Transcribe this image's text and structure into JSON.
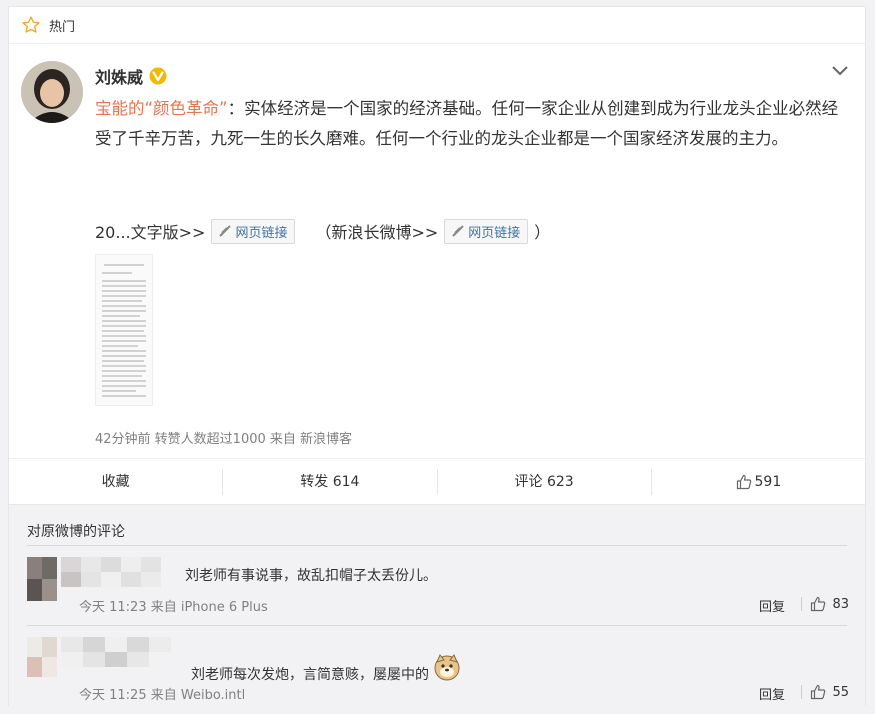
{
  "hot_bar": {
    "label": "热门"
  },
  "post": {
    "author": "刘姝威",
    "text_highlight": "宝能的“颜色革命”",
    "text_body": "：实体经济是一个国家的经济基础。任何一家企业从创建到成为行业龙头企业必然经受了千辛万苦，九死一生的长久磨难。任何一个行业的龙头企业都是一个国家经济发展的主力。",
    "links_prefix": "20...文字版>>",
    "link1_label": "网页链接",
    "links_middle": "（新浪长微博>>",
    "link2_label": "网页链接",
    "links_suffix": "）",
    "meta": "42分钟前 转赞人数超过1000 来自 新浪博客"
  },
  "actions": {
    "collect": "收藏",
    "forward": "转发 614",
    "comment": "评论 623",
    "like": "591"
  },
  "comments": {
    "title": "对原微博的评论",
    "items": [
      {
        "text": "刘老师有事说事，故乱扣帽子太丢份儿。",
        "meta": "今天 11:23 来自 iPhone 6 Plus",
        "reply": "回复",
        "likes": "83"
      },
      {
        "text": "刘老师每次发炮，言简意赅，屡屡中的",
        "meta": "今天 11:25 来自 Weibo.intl",
        "reply": "回复",
        "likes": "55"
      }
    ]
  },
  "colors": {
    "highlight": "#eb7350",
    "link": "#3c73a8",
    "verified": "#f5b800"
  }
}
